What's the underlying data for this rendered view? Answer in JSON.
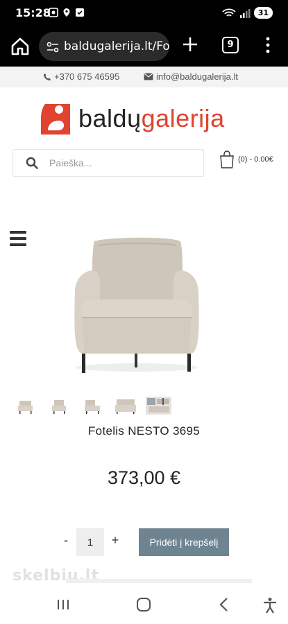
{
  "status_bar": {
    "time": "15:28",
    "battery": "31"
  },
  "browser": {
    "url": "baldugalerija.lt/Fo",
    "tab_count": "9"
  },
  "contact": {
    "phone": "+370 675 46595",
    "email": "info@baldugalerija.lt"
  },
  "logo": {
    "part1": "baldų",
    "part2": "galerija",
    "brand_color": "#e0432f"
  },
  "search": {
    "placeholder": "Paieška..."
  },
  "cart": {
    "summary": "(0) - 0.00€"
  },
  "product": {
    "title": "Fotelis NESTO 3695",
    "price": "373,00 €",
    "quantity": "1",
    "minus_label": "-",
    "plus_label": "+",
    "add_to_cart_label": "Pridėti į krepšelį",
    "button_color": "#6e8591"
  },
  "watermark": {
    "text": "skelbiu.lt"
  }
}
